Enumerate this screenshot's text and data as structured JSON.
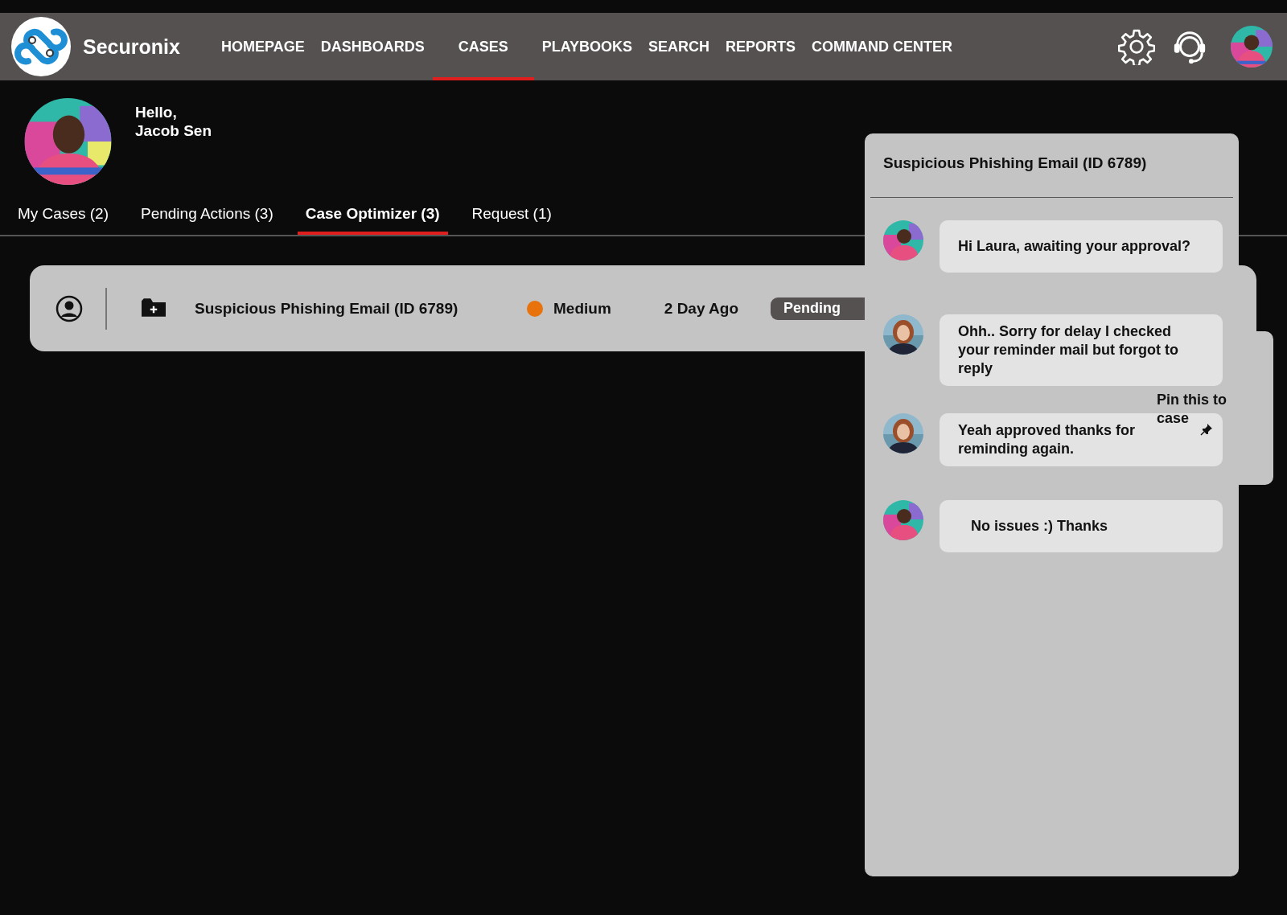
{
  "brand": {
    "name": "Securonix"
  },
  "nav": [
    {
      "label": "HOMEPAGE",
      "selected": false
    },
    {
      "label": "DASHBOARDS",
      "selected": false
    },
    {
      "label": "CASES",
      "selected": true
    },
    {
      "label": "PLAYBOOKS",
      "selected": false
    },
    {
      "label": "SEARCH",
      "selected": false
    },
    {
      "label": "REPORTS",
      "selected": false
    },
    {
      "label": "COMMAND CENTER",
      "selected": false
    }
  ],
  "greeting": {
    "line1": "Hello,",
    "line2": "Jacob Sen"
  },
  "tabs": [
    {
      "label": "My Cases (2)",
      "selected": false
    },
    {
      "label": "Pending Actions (3)",
      "selected": false
    },
    {
      "label": "Case Optimizer (3)",
      "selected": true
    },
    {
      "label": "Request (1)",
      "selected": false
    }
  ],
  "case_row": {
    "title": "Suspicious Phishing Email (ID 6789)",
    "severity": "Medium",
    "age": "2 Day Ago",
    "status": "Pending"
  },
  "chat": {
    "title": "Suspicious Phishing Email (ID 6789)",
    "messages": [
      {
        "kind": "self",
        "text": "Hi Laura, awaiting your approval?"
      },
      {
        "kind": "other",
        "text": "Ohh.. Sorry for delay I checked your reminder mail but forgot to reply"
      },
      {
        "kind": "other",
        "text": "Yeah approved thanks for reminding again.",
        "pin_label": "Pin this to case"
      },
      {
        "kind": "self",
        "text": "No issues :) Thanks"
      }
    ]
  }
}
